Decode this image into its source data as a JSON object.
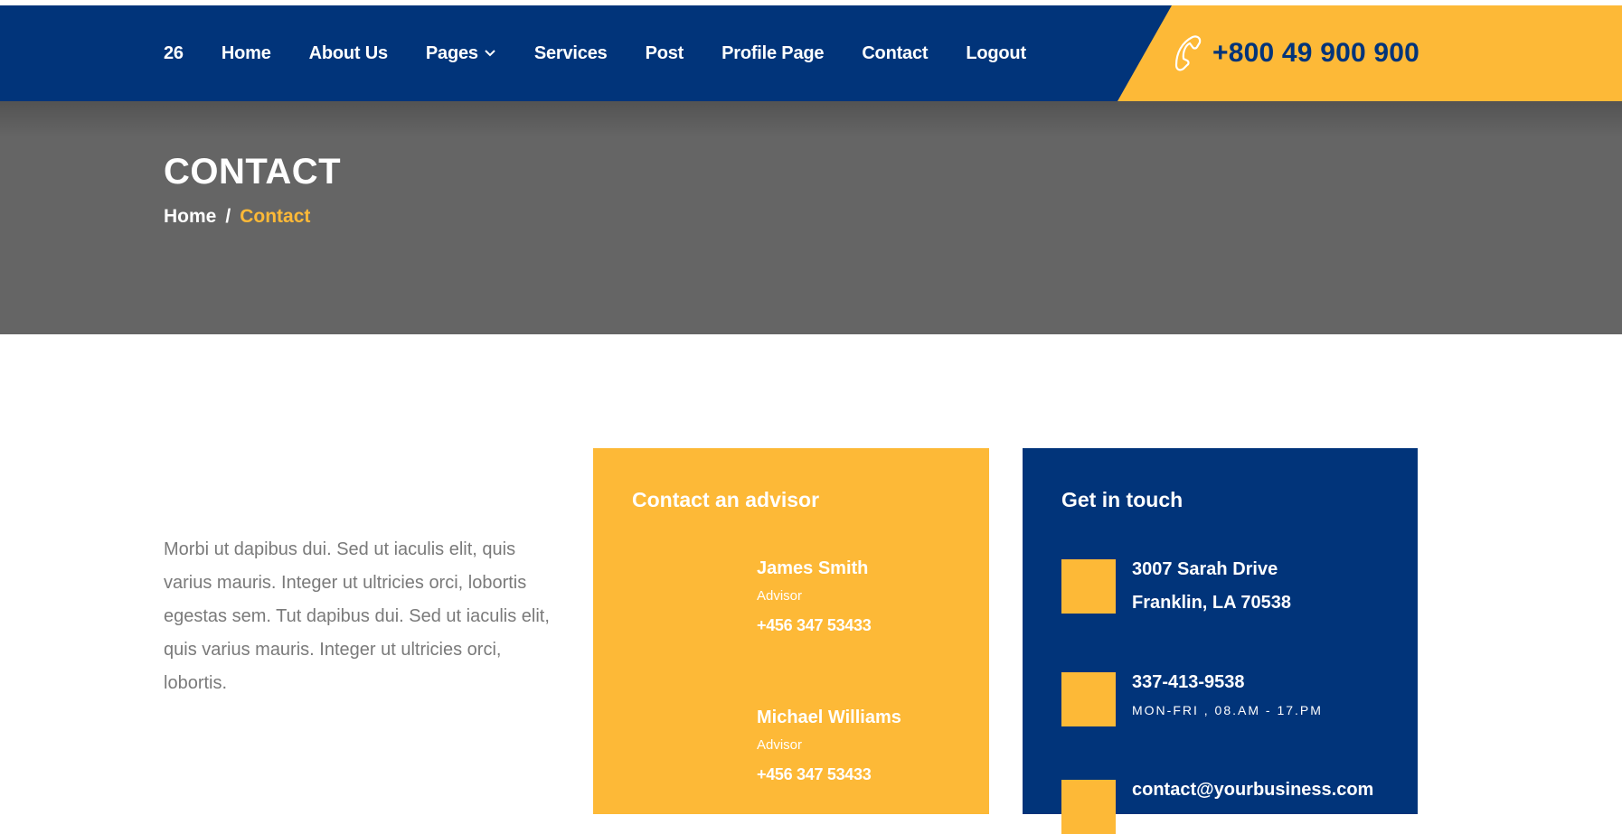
{
  "nav": {
    "items": [
      {
        "label": "26"
      },
      {
        "label": "Home"
      },
      {
        "label": "About Us"
      },
      {
        "label": "Pages"
      },
      {
        "label": "Services"
      },
      {
        "label": "Post"
      },
      {
        "label": "Profile Page"
      },
      {
        "label": "Contact"
      },
      {
        "label": "Logout"
      }
    ],
    "phone": "+800 49 900 900"
  },
  "banner": {
    "title": "CONTACT",
    "breadcrumb": {
      "home": "Home",
      "separator": "/",
      "current": "Contact"
    }
  },
  "intro": {
    "text": "Morbi ut dapibus dui. Sed ut iaculis elit, quis varius mauris. Integer ut ultricies orci, lobortis egestas sem. Tut dapibus dui. Sed ut iaculis elit, quis varius mauris. Integer ut ultricies orci, lobortis."
  },
  "advisor_card": {
    "title": "Contact an advisor",
    "advisors": [
      {
        "name": "James Smith",
        "role": "Advisor",
        "phone": "+456 347 53433"
      },
      {
        "name": "Michael Williams",
        "role": "Advisor",
        "phone": "+456 347 53433"
      }
    ]
  },
  "touch_card": {
    "title": "Get in touch",
    "address_line1": "3007 Sarah Drive",
    "address_line2": "Franklin, LA 70538",
    "phone": "337-413-9538",
    "hours": "MON-FRI , 08.AM - 17.PM",
    "email": "contact@yourbusiness.com"
  },
  "colors": {
    "navy": "#01347a",
    "yellow": "#fdb937",
    "banner_gray": "#656565",
    "body_text": "#7a7a7a"
  }
}
